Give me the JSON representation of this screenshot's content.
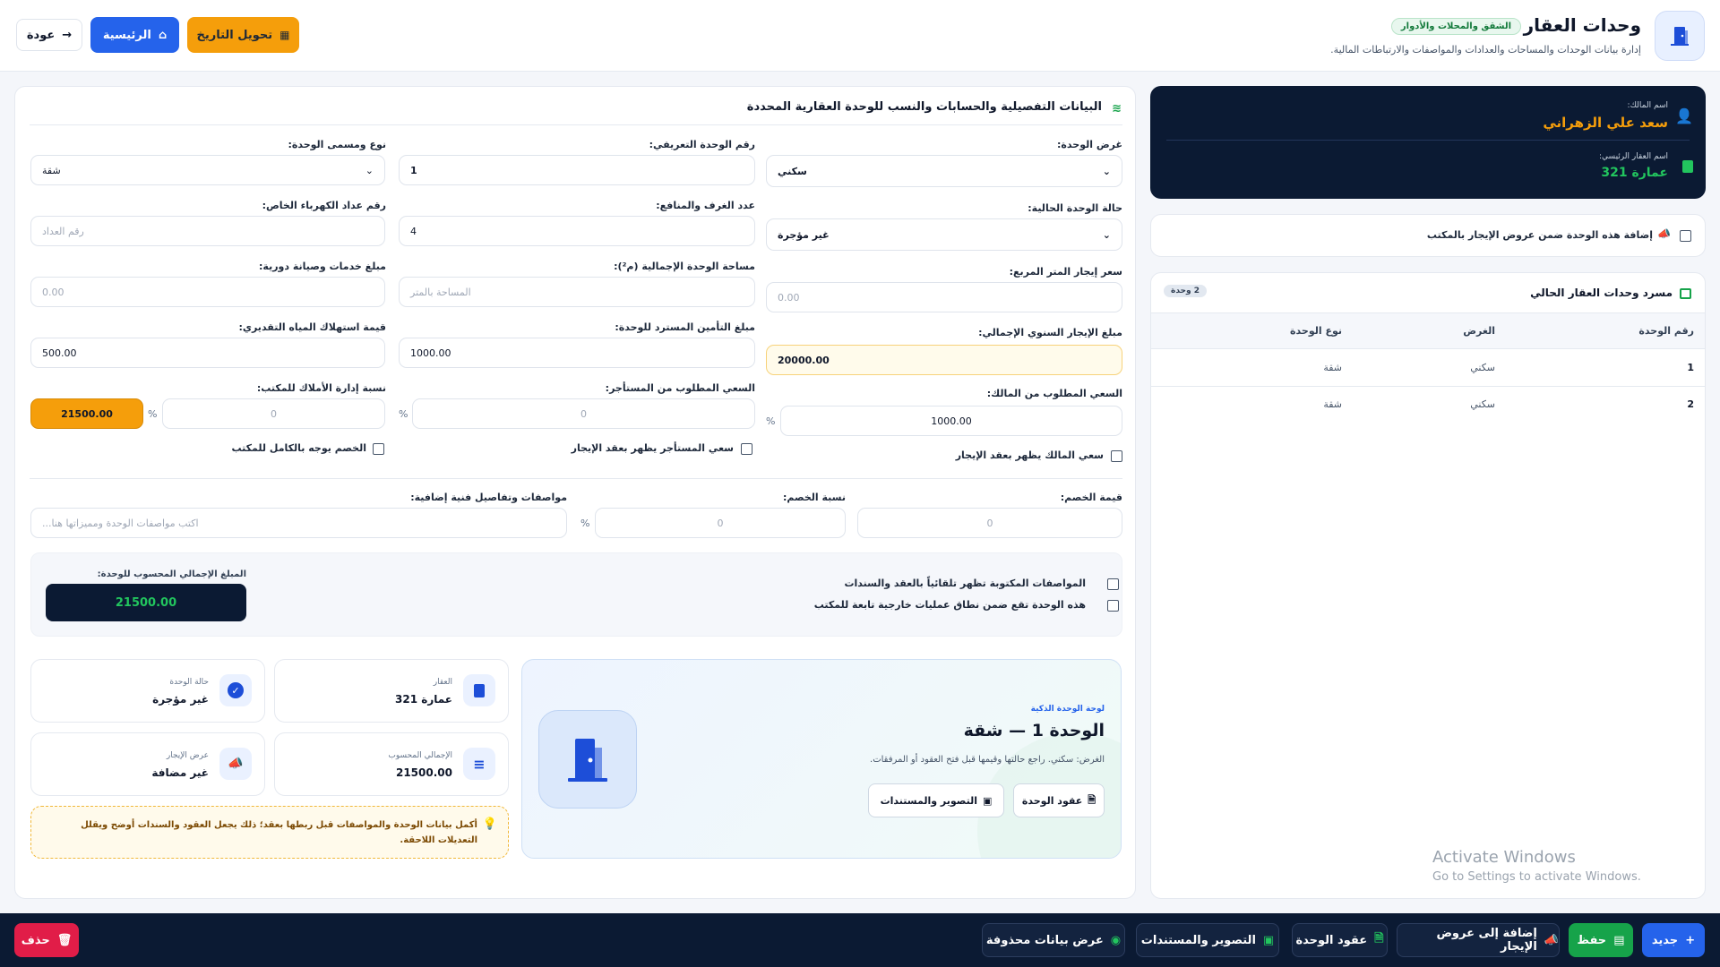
{
  "header": {
    "title": "وحدات العقار",
    "badge": "الشقق والمحلات والأدوار",
    "subtitle": "إدارة بيانات الوحدات والمساحات والعدادات والمواصفات والارتباطات المالية.",
    "btn_convert_date": "تحويل التاريخ",
    "btn_home": "الرئيسية",
    "btn_back": "عودة"
  },
  "owner_card": {
    "owner_label": "اسم المالك:",
    "owner_name": "سعد علي الزهراني",
    "property_label": "اسم العقار الرئيسي:",
    "property_name": "عمارة 321"
  },
  "rent_offer_toggle": {
    "label": "إضافة هذه الوحدة ضمن عروض الإيجار بالمكتب",
    "checked": false
  },
  "units_list": {
    "title": "مسرد وحدات العقار الحالي",
    "count_badge": "2 وحدة",
    "columns": [
      "رقم الوحدة",
      "الغرض",
      "نوع الوحدة"
    ],
    "rows": [
      {
        "no": "1",
        "purpose": "سكني",
        "type": "شقة"
      },
      {
        "no": "2",
        "purpose": "سكني",
        "type": "شقة"
      }
    ]
  },
  "form": {
    "title": "البيانات التفصيلية والحسابات والنسب للوحدة العقارية المحددة",
    "purpose_label": "غرض الوحدة:",
    "purpose_value": "سكني",
    "unit_no_label": "رقم الوحدة التعريفي:",
    "unit_no_value": "1",
    "unit_type_label": "نوع ومسمى الوحدة:",
    "unit_type_value": "شقة",
    "status_label": "حالة الوحدة الحالية:",
    "status_value": "غير مؤجرة",
    "rooms_label": "عدد الغرف والمنافع:",
    "rooms_value": "4",
    "meter_label": "رقم عداد الكهرباء الخاص:",
    "meter_placeholder": "رقم العداد",
    "sqm_price_label": "سعر إيجار المتر المربع:",
    "sqm_price_placeholder": "0.00",
    "area_label": "مساحة الوحدة الإجمالية (م²):",
    "area_placeholder": "المساحة بالمتر",
    "service_label": "مبلغ خدمات وصيانة دورية:",
    "service_placeholder": "0.00",
    "annual_rent_label": "مبلغ الإيجار السنوي الإجمالي:",
    "annual_rent_value": "20000.00",
    "deposit_label": "مبلغ التأمين المسترد للوحدة:",
    "deposit_value": "1000.00",
    "water_label": "قيمة استهلاك المياه التقديري:",
    "water_value": "500.00",
    "owner_fee_label": "السعي المطلوب من المالك:",
    "owner_fee_value": "1000.00",
    "tenant_fee_label": "السعي المطلوب من المستأجر:",
    "tenant_fee_placeholder": "0",
    "mgmt_pct_label": "نسبة إدارة الأملاك للمكتب:",
    "mgmt_pct_placeholder": "0",
    "mgmt_total": "21500.00",
    "pct_symbol": "%",
    "owner_fee_contract_label": "سعي المالك يظهر بعقد الإيجار",
    "tenant_fee_contract_label": "سعي المستأجر يظهر بعقد الإيجار",
    "discount_office_label": "الخصم يوجه بالكامل للمكتب",
    "discount_value_label": "قيمة الخصم:",
    "discount_value_placeholder": "0",
    "discount_pct_label": "نسبة الخصم:",
    "discount_pct_placeholder": "0",
    "specs_label": "مواصفات وتفاصيل فنية إضافية:",
    "specs_placeholder": "اكتب مواصفات الوحدة ومميزاتها هنا...",
    "specs_auto_label": "المواصفات المكتوبة تظهر تلقائياً بالعقد والسندات",
    "external_ops_label": "هذه الوحدة تقع ضمن نطاق عمليات خارجية تابعة للمكتب",
    "total_label": "المبلغ الإجمالي المحسوب للوحدة:",
    "total_value": "21500.00"
  },
  "smart_card": {
    "kicker": "لوحة الوحدة الذكية",
    "title": "الوحدة 1 — شقة",
    "desc": "الغرض: سكني. راجع حالتها وقيمها قبل فتح العقود أو المرفقات.",
    "btn_contracts": "عقود الوحدة",
    "btn_docs": "التصوير والمستندات"
  },
  "mini_cards": {
    "property_title": "العقار",
    "property_value": "عمارة 321",
    "status_title": "حالة الوحدة",
    "status_value": "غير مؤجرة",
    "total_title": "الإجمالي المحسوب",
    "total_value": "21500.00",
    "offer_title": "عرض الإيجار",
    "offer_value": "غير مضافة"
  },
  "tip": "أكمل بيانات الوحدة والمواصفات قبل ربطها بعقد؛ ذلك يجعل العقود والسندات أوضح ويقلل التعديلات اللاحقة.",
  "watermark": {
    "line1": "Activate Windows",
    "line2": "Go to Settings to activate Windows."
  },
  "bottom_bar": {
    "new": "جديد",
    "save": "حفظ",
    "add_offer": "إضافة إلى عروض الإيجار",
    "contracts": "عقود الوحدة",
    "docs": "التصوير والمستندات",
    "show_deleted": "عرض بيانات محذوفة",
    "delete": "حذف"
  },
  "colors": {
    "accent_blue": "#2563eb",
    "orange": "#f59e0b",
    "dark_navy": "#0b1a33",
    "green": "#16a34a",
    "red": "#e11d48"
  }
}
